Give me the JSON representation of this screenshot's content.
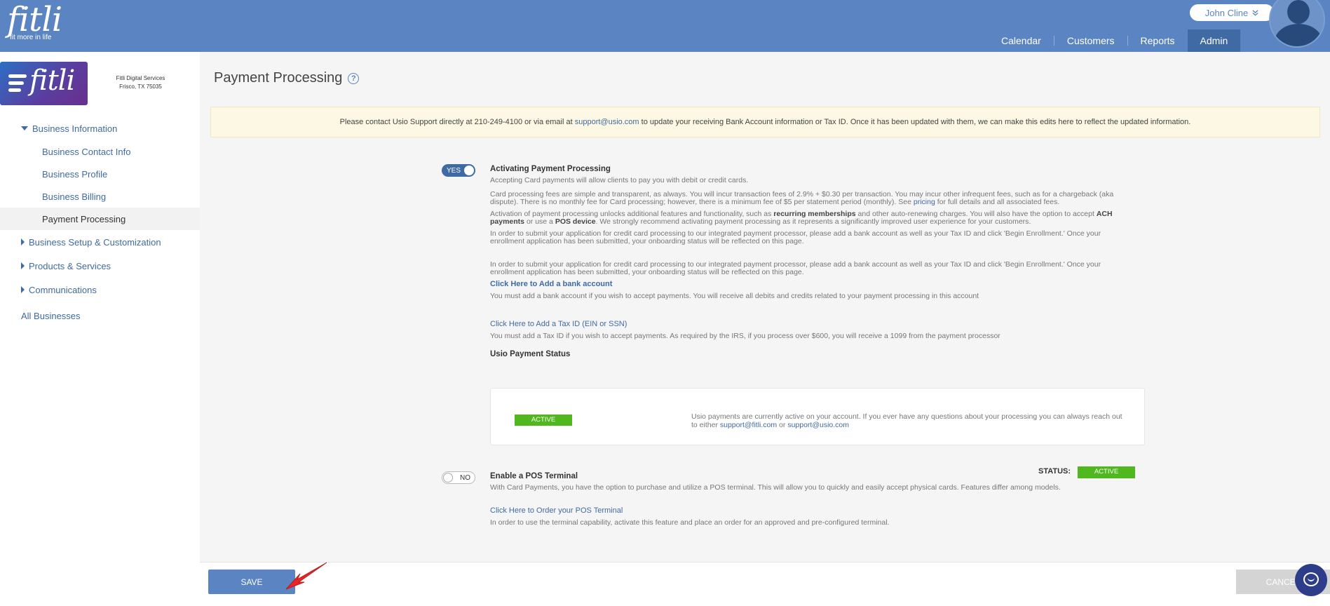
{
  "header": {
    "brand": "fitli",
    "tagline": "fit more in life",
    "user_name": "John Cline",
    "nav": [
      {
        "label": "Calendar"
      },
      {
        "label": "Customers"
      },
      {
        "label": "Reports"
      },
      {
        "label": "Admin",
        "active": true
      }
    ]
  },
  "sidebar": {
    "logo_text": "fitli",
    "business_name": "Fitli Digital Services",
    "business_location": "Frisco, TX 75035",
    "nav": {
      "business_information": "Business Information",
      "business_contact_info": "Business Contact Info",
      "business_profile": "Business Profile",
      "business_billing": "Business Billing",
      "payment_processing": "Payment Processing",
      "business_setup": "Business Setup & Customization",
      "products_services": "Products & Services",
      "communications": "Communications",
      "all_businesses": "All Businesses"
    }
  },
  "main": {
    "title": "Payment Processing",
    "help_icon": "?",
    "alert": {
      "before": "Please contact Usio Support directly at 210-249-4100 or via email at ",
      "email": "support@usio.com",
      "after": " to update your receiving Bank Account information or Tax ID. Once it has been updated with them, we can make this edits here to reflect the updated information."
    },
    "payment_processing": {
      "toggle_label": "YES",
      "toggle_on": true,
      "heading": "Activating Payment Processing",
      "p1": "Accepting Card payments will allow clients to pay you with debit or credit cards.",
      "p2_before": "Card processing fees are simple and transparent, as always. You will incur transaction fees of 2.9% + $0.30 per transaction. You may incur other infrequent fees, such as for a chargeback (aka dispute). There is no monthly fee for Card processing; however, there is a minimum fee of $5 per statement period (monthly). See ",
      "p2_link": "pricing",
      "p2_after": " for full details and all associated fees.",
      "p3_a": "Activation of payment processing unlocks additional features and functionality, such as ",
      "p3_b": "recurring memberships",
      "p3_c": " and other auto-renewing charges. You will also have the option to accept ",
      "p3_d": "ACH payments",
      "p3_e": " or use a ",
      "p3_f": "POS device",
      "p3_g": ". We strongly recommend activating payment processing as it represents a significantly improved user experience for your customers.",
      "p4": "In order to submit your application for credit card processing to our integrated payment processor, please add a bank account as well as your Tax ID and click 'Begin Enrollment.' Once your enrollment application has been submitted, your onboarding status will be reflected on this page.",
      "p5": "In order to submit your application for credit card processing to our integrated payment processor, please add a bank account as well as your Tax ID and click 'Begin Enrollment.' Once your enrollment application has been submitted, your onboarding status will be reflected on this page.",
      "bank_link": "Click Here to Add a bank account",
      "bank_note": "You must add a bank account if you wish to accept payments. You will receive all debits and credits related to your payment processing in this account",
      "tax_link": "Click Here to Add a Tax ID (EIN or SSN)",
      "tax_note": "You must add a Tax ID if you wish to accept payments. As required by the IRS, if you process over $600, you will receive a 1099 from the payment processor",
      "status_heading": "Usio Payment Status",
      "status_badge": "ACTIVE",
      "status_text_before": "Usio payments are currently active on your account. If you ever have any questions about your processing you can always reach out to either ",
      "status_email1": "support@fitli.com",
      "status_or": " or ",
      "status_email2": "support@usio.com"
    },
    "pos": {
      "toggle_label": "NO",
      "toggle_on": false,
      "heading": "Enable a POS Terminal",
      "status_label": "STATUS:",
      "status_badge": "ACTIVE",
      "desc": "With Card Payments, you have the option to purchase and utilize a POS terminal. This will allow you to quickly and easily accept physical cards. Features differ among models.",
      "order_link": "Click Here to Order your POS Terminal",
      "order_note": "In order to use the terminal capability, activate this feature and place an order for an approved and pre-configured terminal."
    },
    "footer": {
      "save": "SAVE",
      "cancel": "CANCEL"
    }
  },
  "colors": {
    "header": "#5a85c2",
    "link": "#3f6aa3",
    "active_badge": "#4fb81e",
    "alert_bg": "#fcf8e3",
    "chat": "#2e3d8a",
    "annotation_arrow": "#e8262a"
  },
  "icons": {
    "help": "question-circle-icon",
    "user_caret": "double-chevron-down-icon",
    "chat": "chat-bubble-icon",
    "annotation": "red-arrow-annotation"
  }
}
